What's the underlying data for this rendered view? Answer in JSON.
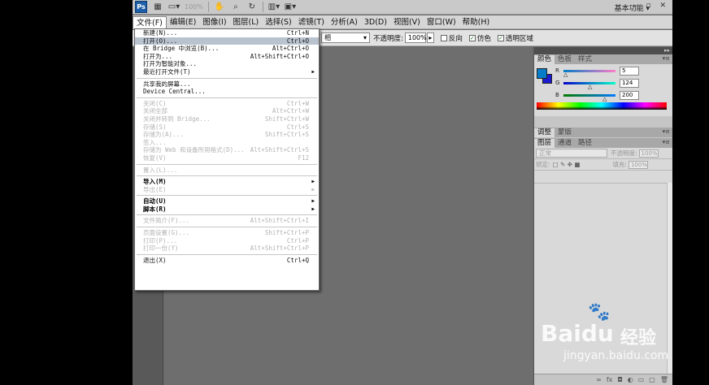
{
  "appbar": {
    "logo": "Ps",
    "zoom": "100%",
    "workspace": "基本功能",
    "workspace_arrow": "▾",
    "window_controls": "– ▫ ✕"
  },
  "menubar": {
    "items": [
      "文件(F)",
      "编辑(E)",
      "图像(I)",
      "图层(L)",
      "选择(S)",
      "滤镜(T)",
      "分析(A)",
      "3D(D)",
      "视图(V)",
      "窗口(W)",
      "帮助(H)"
    ]
  },
  "options": {
    "mode_partial": "相",
    "opacity_label": "不透明度:",
    "opacity_value": "100%",
    "reverse_label": "反向",
    "dither_label": "仿色",
    "transparency_label": "透明区域"
  },
  "file_menu": {
    "items": [
      {
        "label": "新建(N)...",
        "shortcut": "Ctrl+N"
      },
      {
        "label": "打开(O)...",
        "shortcut": "Ctrl+O",
        "highlight": true
      },
      {
        "label": "在 Bridge 中浏览(B)...",
        "shortcut": "Alt+Ctrl+O"
      },
      {
        "label": "打开为...",
        "shortcut": "Alt+Shift+Ctrl+O"
      },
      {
        "label": "打开为智能对象..."
      },
      {
        "label": "最近打开文件(T)",
        "submenu": true
      },
      {
        "sep": true
      },
      {
        "label": "共享我的屏幕..."
      },
      {
        "label": "Device Central..."
      },
      {
        "sep": true
      },
      {
        "label": "关闭(C)",
        "shortcut": "Ctrl+W",
        "disabled": true
      },
      {
        "label": "关闭全部",
        "shortcut": "Alt+Ctrl+W",
        "disabled": true
      },
      {
        "label": "关闭并转到 Bridge...",
        "shortcut": "Shift+Ctrl+W",
        "disabled": true
      },
      {
        "label": "存储(S)",
        "shortcut": "Ctrl+S",
        "disabled": true
      },
      {
        "label": "存储为(A)...",
        "shortcut": "Shift+Ctrl+S",
        "disabled": true
      },
      {
        "label": "签入...",
        "disabled": true
      },
      {
        "label": "存储为 Web 和设备所用格式(D)...",
        "shortcut": "Alt+Shift+Ctrl+S",
        "disabled": true
      },
      {
        "label": "恢复(V)",
        "shortcut": "F12",
        "disabled": true
      },
      {
        "sep": true
      },
      {
        "label": "置入(L)...",
        "disabled": true
      },
      {
        "sep": true
      },
      {
        "label": "导入(M)",
        "submenu": true,
        "bold": true
      },
      {
        "label": "导出(E)",
        "submenu": true,
        "disabled": true
      },
      {
        "sep": true
      },
      {
        "label": "自动(U)",
        "submenu": true,
        "bold": true
      },
      {
        "label": "脚本(R)",
        "submenu": true,
        "bold": true
      },
      {
        "sep": true
      },
      {
        "label": "文件简介(F)...",
        "shortcut": "Alt+Shift+Ctrl+I",
        "disabled": true
      },
      {
        "sep": true
      },
      {
        "label": "页面设置(G)...",
        "shortcut": "Shift+Ctrl+P",
        "disabled": true
      },
      {
        "label": "打印(P)...",
        "shortcut": "Ctrl+P",
        "disabled": true
      },
      {
        "label": "打印一份(Y)",
        "shortcut": "Alt+Shift+Ctrl+P",
        "disabled": true
      },
      {
        "sep": true
      },
      {
        "label": "退出(X)",
        "shortcut": "Ctrl+Q"
      }
    ]
  },
  "color_panel": {
    "tabs": [
      "颜色",
      "色板",
      "样式"
    ],
    "fg_color": "#057cc8",
    "bg_color": "#1b1bd0",
    "r_label": "R",
    "g_label": "G",
    "b_label": "B",
    "r": "5",
    "g": "124",
    "b": "200"
  },
  "adjust_panel": {
    "tabs": [
      "调整",
      "蒙版"
    ]
  },
  "layers_panel": {
    "tabs": [
      "图层",
      "通道",
      "路径"
    ],
    "blend_mode": "正常",
    "opacity_label": "不透明度:",
    "opacity_value": "100%",
    "lock_label": "锁定:",
    "fill_label": "填充:",
    "fill_value": "100%"
  },
  "watermark": {
    "brand": "Bai",
    "brand2": "du",
    "cn": "经验",
    "url": "jingyan.baidu.com"
  }
}
